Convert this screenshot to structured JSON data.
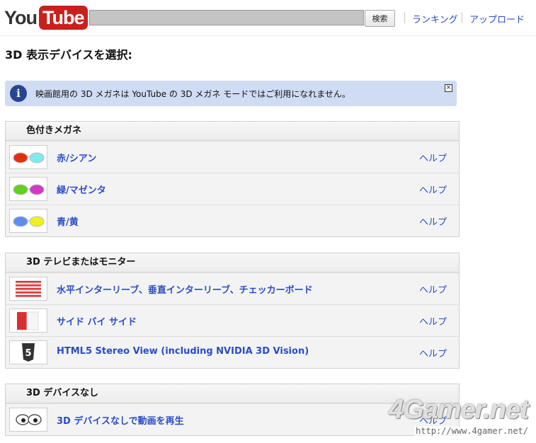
{
  "header": {
    "logo_you": "You",
    "logo_tube": "Tube",
    "search_value": "",
    "search_button": "検索",
    "nav": [
      "ランキング",
      "アップロード"
    ]
  },
  "page_title": "3D 表示デバイスを選択:",
  "info": {
    "text": "映画館用の 3D メガネは YouTube の 3D メガネ モードではご利用になれません。",
    "close": "✕"
  },
  "groups": [
    {
      "title": "色付きメガネ",
      "items": [
        {
          "label": "赤/シアン",
          "help": "ヘルプ",
          "icon": "red-cyan-glasses-icon"
        },
        {
          "label": "緑/マゼンタ",
          "help": "ヘルプ",
          "icon": "green-magenta-glasses-icon"
        },
        {
          "label": "青/黄",
          "help": "ヘルプ",
          "icon": "blue-yellow-glasses-icon"
        }
      ]
    },
    {
      "title": "3D テレビまたはモニター",
      "items": [
        {
          "label": "水平インターリーブ、垂直インターリーブ、チェッカーボード",
          "help": "ヘルプ",
          "icon": "interleave-icon"
        },
        {
          "label": "サイド バイ サイド",
          "help": "ヘルプ",
          "icon": "side-by-side-icon"
        },
        {
          "label": "HTML5 Stereo View (including NVIDIA 3D Vision)",
          "help": "ヘルプ",
          "icon": "html5-icon"
        }
      ]
    },
    {
      "title": "3D デバイスなし",
      "items": [
        {
          "label": "3D デバイスなしで動画を再生",
          "help": "ヘルプ",
          "icon": "eyes-icon"
        }
      ]
    }
  ],
  "watermark": {
    "title": "4Gamer.net",
    "url": "http://www.4gamer.net/"
  },
  "colors": {
    "link": "#2a4cc7",
    "info_bg": "#cfdcf3",
    "logo_red": "#c8201d"
  }
}
